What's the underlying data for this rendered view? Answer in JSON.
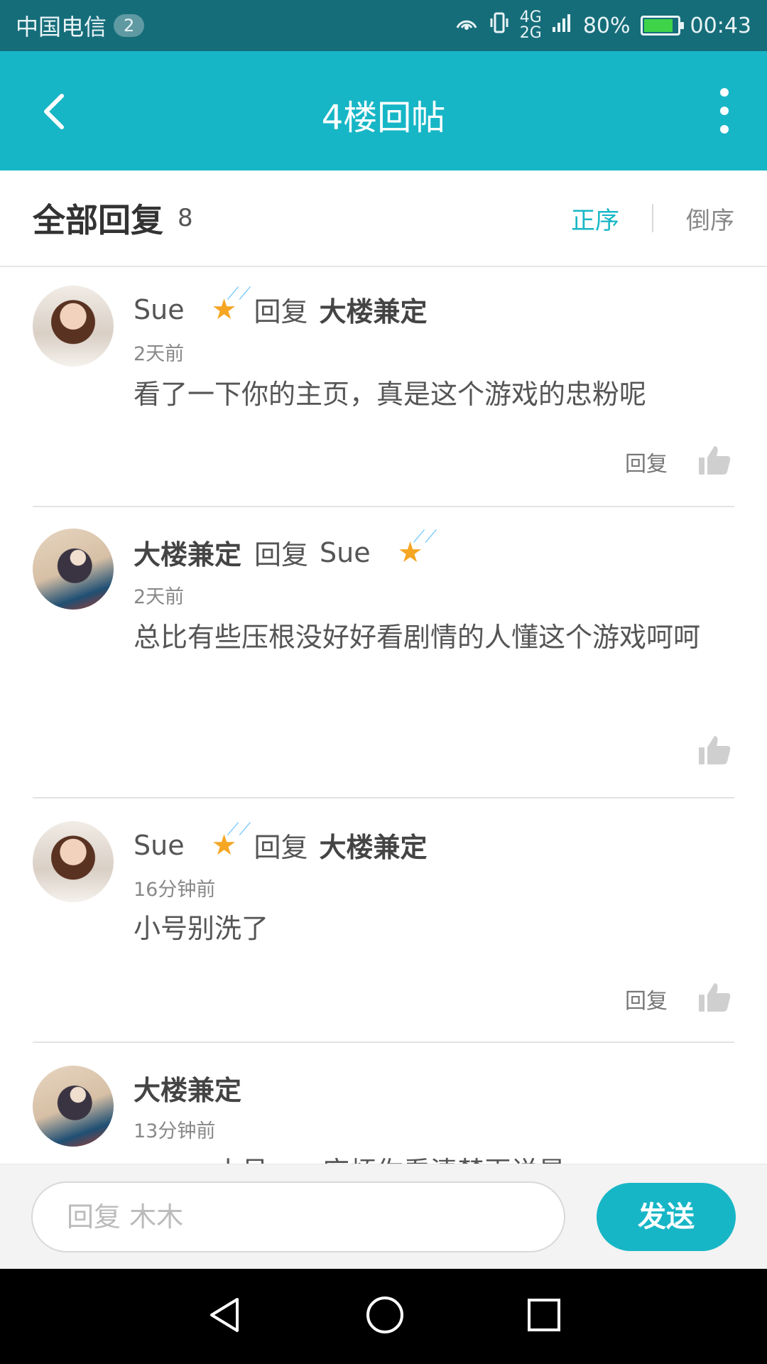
{
  "status_bar": {
    "carrier": "中国电信",
    "sim_slot": "2",
    "network": "4G",
    "network2": "2G",
    "battery_percent": "80%",
    "battery_level": 0.8,
    "time": "00:43"
  },
  "app_bar": {
    "title": "4楼回帖"
  },
  "header": {
    "title": "全部回复",
    "count": "8",
    "sort_asc": "正序",
    "sort_desc": "倒序"
  },
  "replies": [
    {
      "user": "Sue",
      "reply_word": "回复",
      "target": "大楼兼定",
      "time": "2天前",
      "content": "看了一下你的主页，真是这个游戏的忠粉呢",
      "reply_label": "回复"
    },
    {
      "user": "大楼兼定",
      "reply_word": "回复",
      "target": "Sue",
      "time": "2天前",
      "content": "总比有些压根没好好看剧情的人懂这个游戏呵呵"
    },
    {
      "user": "Sue",
      "reply_word": "回复",
      "target": "大楼兼定",
      "time": "16分钟前",
      "content": "小号别洗了",
      "reply_label": "回复"
    },
    {
      "user": "大楼兼定",
      "time": "13分钟前",
      "content": "。。。。。小号。。。麻烦你看清楚再说是"
    }
  ],
  "input": {
    "placeholder": "回复 木木",
    "send_label": "发送"
  },
  "colors": {
    "status_bar": "#166d7a",
    "accent": "#17b6c6"
  }
}
